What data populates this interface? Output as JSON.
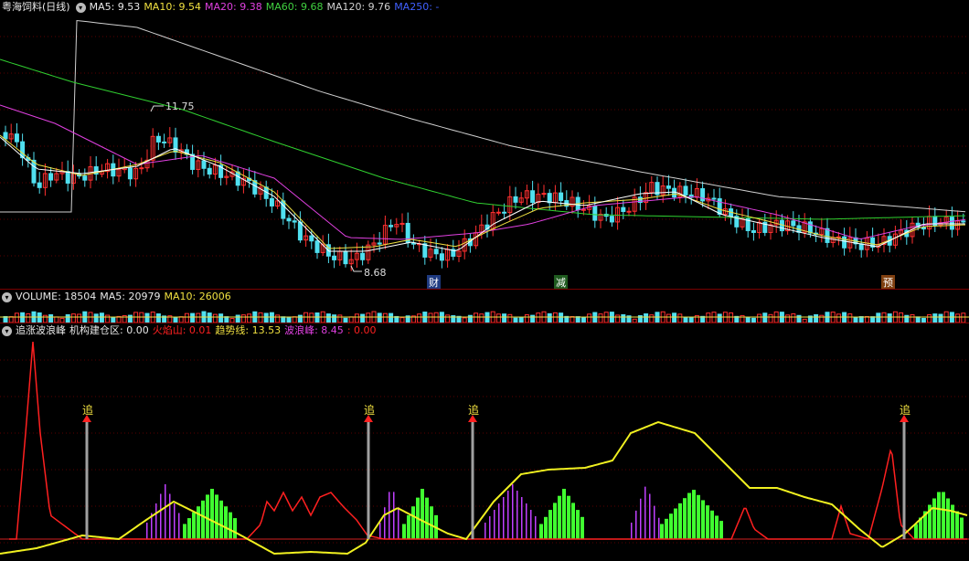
{
  "main_header": {
    "title": "粤海饲料(日线)",
    "ma5": "MA5: 9.53",
    "ma10": "MA10: 9.54",
    "ma20": "MA20: 9.38",
    "ma60": "MA60: 9.68",
    "ma120": "MA120: 9.76",
    "ma250": "MA250: -"
  },
  "main_chart": {
    "high_label": "11.75",
    "low_label": "8.68",
    "markers": [
      {
        "text": "财",
        "color": "#3a78ff"
      },
      {
        "text": "减",
        "color": "#40c040"
      },
      {
        "text": "预",
        "color": "#e07020"
      }
    ]
  },
  "volume_header": {
    "volume": "VOLUME: 18504",
    "ma5": "MA5: 20979",
    "ma10": "MA10: 26006"
  },
  "indicator_header": {
    "name": "追涨波浪峰",
    "jigou": "机构建仓区: 0.00",
    "huoyan": "火焰山: 0.01",
    "qushi": "趋势线: 13.53",
    "langfeng": "波浪峰: 8.45",
    "extra": ": 0.00"
  },
  "signals": {
    "label": "追"
  },
  "colors": {
    "up": "#ff3030",
    "down": "#50e0f0",
    "ma5": "#ffffff",
    "ma10": "#f0e040",
    "ma20": "#e040e0",
    "ma60": "#30d030",
    "ma120": "#d0d0d0",
    "trend": "#f0f020",
    "flame": "#ff2020",
    "bar_green": "#40ff30",
    "bar_purple": "#c040ff"
  }
}
